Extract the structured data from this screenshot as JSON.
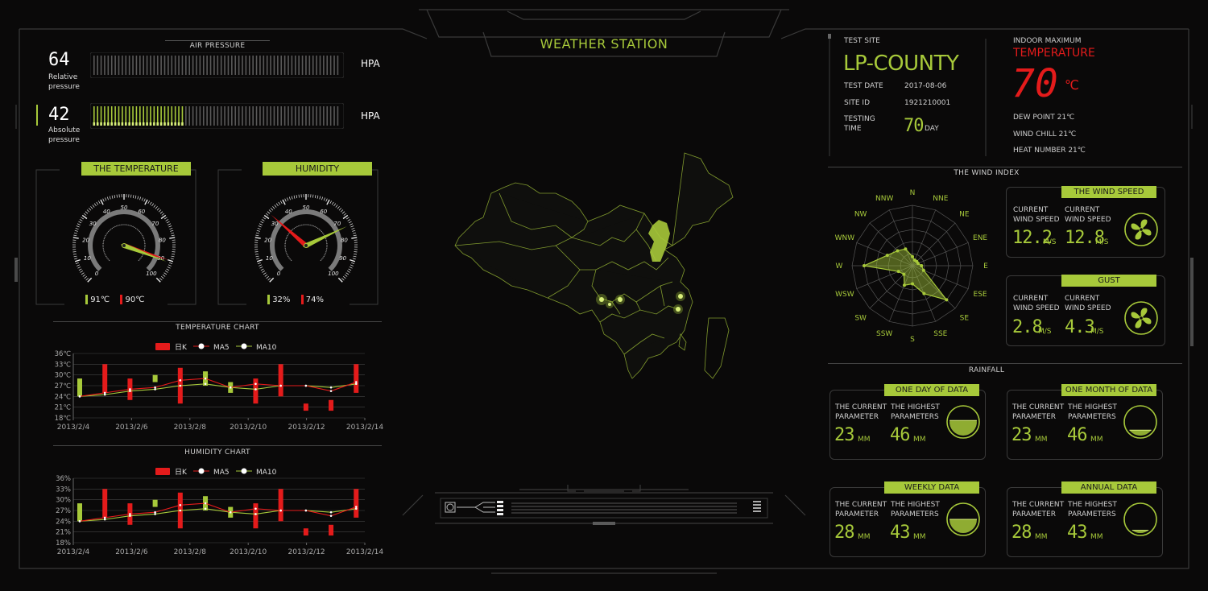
{
  "title": "WEATHER STATION",
  "air_pressure": {
    "title": "AIR PRESSURE",
    "relative": {
      "value": "64",
      "label1": "Relative",
      "label2": "pressure",
      "unit": "HPA",
      "fill": 0.0
    },
    "absolute": {
      "value": "42",
      "label1": "Absolute",
      "label2": "pressure",
      "unit": "HPA",
      "fill": 0.36
    }
  },
  "temperature_gauge": {
    "title": "THE TEMPERATURE",
    "ticks": [
      "0",
      "10",
      "20",
      "30",
      "40",
      "50",
      "60",
      "70",
      "80",
      "90",
      "100"
    ],
    "legend": [
      {
        "value": "91℃",
        "color": "#a7c93a"
      },
      {
        "value": "90℃",
        "color": "#e41b1b"
      }
    ],
    "needle_green": 91,
    "needle_red": 90
  },
  "humidity_gauge": {
    "title": "HUMIDITY",
    "ticks": [
      "0",
      "10",
      "20",
      "30",
      "40",
      "50",
      "60",
      "70",
      "80",
      "90",
      "100"
    ],
    "legend": [
      {
        "value": "32%",
        "color": "#a7c93a"
      },
      {
        "value": "74%",
        "color": "#e41b1b"
      }
    ],
    "needle_green": 74,
    "needle_red": 32
  },
  "temperature_chart": {
    "title": "TEMPERATURE CHART",
    "legend": [
      "日K",
      "MA5",
      "MA10"
    ],
    "yticks": [
      "36℃",
      "33℃",
      "30℃",
      "27℃",
      "24℃",
      "21℃",
      "18℃"
    ],
    "xticks": [
      "2013/2/4",
      "2013/2/6",
      "2013/2/8",
      "2013/2/10",
      "2013/2/12",
      "2013/2/14"
    ]
  },
  "humidity_chart": {
    "title": "HUMIDITY CHART",
    "legend": [
      "日K",
      "MA5",
      "MA10"
    ],
    "yticks": [
      "36%",
      "33%",
      "30%",
      "27%",
      "24%",
      "21%",
      "18%"
    ],
    "xticks": [
      "2013/2/4",
      "2013/2/6",
      "2013/2/8",
      "2013/2/10",
      "2013/2/12",
      "2013/2/14"
    ]
  },
  "candles": [
    {
      "o": 24,
      "c": 29,
      "up": true
    },
    {
      "o": 25,
      "c": 33,
      "up": false
    },
    {
      "o": 29,
      "c": 23,
      "up": false
    },
    {
      "o": 28,
      "c": 30,
      "up": true
    },
    {
      "o": 32,
      "c": 22,
      "up": false
    },
    {
      "o": 27,
      "c": 31,
      "up": true
    },
    {
      "o": 28,
      "c": 25,
      "up": true
    },
    {
      "o": 29,
      "c": 22,
      "up": false
    },
    {
      "o": 33,
      "c": 24,
      "up": false
    },
    {
      "o": 22,
      "c": 20,
      "up": false
    },
    {
      "o": 23,
      "c": 20,
      "up": false
    },
    {
      "o": 25,
      "c": 33,
      "up": false
    }
  ],
  "ma5": [
    24,
    25,
    26,
    26.5,
    28.5,
    29,
    26.5,
    27.5,
    27,
    27,
    25.5,
    28
  ],
  "ma10": [
    24,
    24.5,
    25.5,
    26,
    27,
    27.5,
    26.5,
    26,
    27,
    27,
    26.5,
    27.5
  ],
  "site": {
    "test_site_label": "TEST SITE",
    "name": "LP-COUNTY",
    "test_date_label": "TEST DATE",
    "test_date": "2017-08-06",
    "site_id_label": "SITE ID",
    "site_id": "1921210001",
    "testing_label1": "TESTING",
    "testing_label2": "TIME",
    "testing_value": "70",
    "testing_unit": "DAY"
  },
  "indoor": {
    "label": "INDOOR MAXIMUM",
    "title": "TEMPERATURE",
    "value": "70",
    "unit": "℃",
    "dew_point": "DEW POINT 21℃",
    "wind_chill": "WIND CHILL 21℃",
    "heat_number": "HEAT NUMBER 21℃"
  },
  "wind_index": {
    "title": "THE WIND INDEX",
    "directions": [
      "N",
      "NNE",
      "NE",
      "ENE",
      "E",
      "ESE",
      "SE",
      "SSE",
      "S",
      "SSW",
      "SW",
      "WSW",
      "W",
      "WNW",
      "NW",
      "NNW"
    ],
    "values": [
      0.15,
      0.1,
      0.1,
      0.1,
      0.15,
      0.2,
      0.8,
      0.5,
      0.3,
      0.35,
      0.2,
      0.25,
      0.8,
      0.45,
      0.35,
      0.3
    ]
  },
  "wind_speed": {
    "title": "THE WIND SPEED",
    "label_a1": "CURRENT",
    "label_a2": "WIND SPEED",
    "value_a": "12.2",
    "unit_a": "M/S",
    "label_b1": "CURRENT",
    "label_b2": "WIND SPEED",
    "value_b": "12.8",
    "unit_b": "M/S"
  },
  "gust": {
    "title": "GUST",
    "label_a1": "CURRENT",
    "label_a2": "WIND SPEED",
    "value_a": "2.8",
    "unit_a": "M/S",
    "label_b1": "CURRENT",
    "label_b2": "WIND SPEED",
    "value_b": "4.3",
    "unit_b": "M/S"
  },
  "rainfall": {
    "title": "RAINFALL",
    "cards": [
      {
        "title": "ONE DAY OF DATA",
        "l1": "THE CURRENT",
        "l2": "PARAMETER",
        "h1": "THE HIGHEST",
        "h2": "PARAMETERS",
        "current": "23",
        "highest": "46",
        "unit": "MM",
        "level": 0.55
      },
      {
        "title": "ONE MONTH OF DATA",
        "l1": "THE CURRENT",
        "l2": "PARAMETER",
        "h1": "THE HIGHEST",
        "h2": "PARAMETERS",
        "current": "23",
        "highest": "46",
        "unit": "MM",
        "level": 0.2
      },
      {
        "title": "WEEKLY DATA",
        "l1": "THE CURRENT",
        "l2": "PARAMETER",
        "h1": "THE HIGHEST",
        "h2": "PARAMETERS",
        "current": "28",
        "highest": "43",
        "unit": "MM",
        "level": 0.5
      },
      {
        "title": "ANNUAL DATA",
        "l1": "THE CURRENT",
        "l2": "PARAMETER",
        "h1": "THE HIGHEST",
        "h2": "PARAMETERS",
        "current": "28",
        "highest": "43",
        "unit": "MM",
        "level": 0.1
      }
    ]
  },
  "colors": {
    "accent": "#a7c93a",
    "alert": "#e41b1b",
    "frame": "#3a3a3a"
  }
}
